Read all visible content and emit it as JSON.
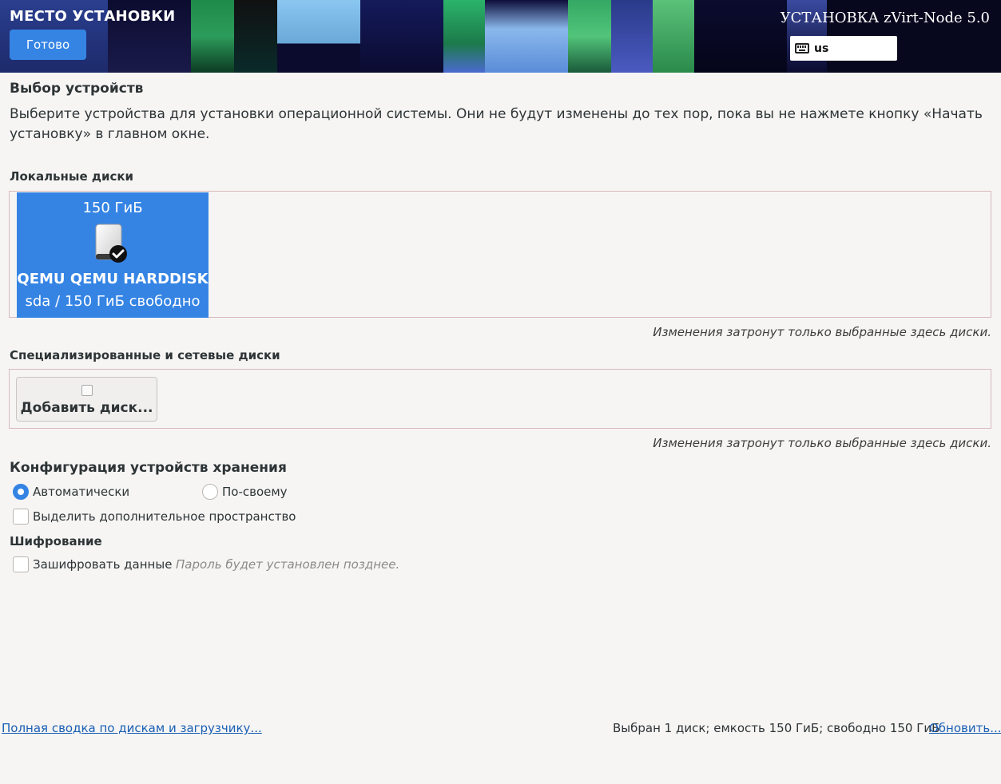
{
  "header": {
    "title": "МЕСТО УСТАНОВКИ",
    "done_label": "Готово",
    "product_title": "УСТАНОВКА zVirt-Node 5.0",
    "keyboard_layout": "us",
    "banner_colors": [
      "#1d2a6b",
      "#12123a",
      "#2c9c5a",
      "#0a2a2a",
      "#6aa8d8",
      "#141a5a",
      "#2bb36a",
      "#8ab8ec",
      "#0e0e3a",
      "#34a864",
      "#2a3a8a",
      "#5bc27a",
      "#111",
      "#0b0b2e"
    ]
  },
  "main": {
    "title": "Выбор устройств",
    "description": "Выберите устройства для установки операционной системы. Они не будут изменены до тех пор, пока вы не нажмете кнопку «Начать установку» в главном окне."
  },
  "local_disks": {
    "label": "Локальные диски",
    "disk": {
      "size": "150 ГиБ",
      "name": "QEMU QEMU HARDDISK",
      "free": "sda  /  150 ГиБ свободно",
      "selected": true
    },
    "hint": "Изменения затронут только выбранные здесь диски."
  },
  "network_disks": {
    "label": "Специализированные и сетевые диски",
    "add_label": "Добавить диск...",
    "hint": "Изменения затронут только выбранные здесь диски."
  },
  "storage": {
    "title": "Конфигурация устройств хранения",
    "auto_label": "Автоматически",
    "custom_label": "По-своему",
    "selected": "auto",
    "reclaim_label": "Выделить дополнительное пространство"
  },
  "encryption": {
    "title": "Шифрование",
    "encrypt_label": "Зашифровать данные",
    "note": "Пароль будет установлен позднее."
  },
  "footer": {
    "summary_link": "Полная сводка по дискам и загрузчику...",
    "status": "Выбран 1 диск; емкость 150 ГиБ; свободно 150 ГиБ",
    "refresh_link": "Обновить..."
  },
  "colors": {
    "accent": "#3584e4",
    "link": "#1a5fb4",
    "background": "#f6f5f4"
  }
}
